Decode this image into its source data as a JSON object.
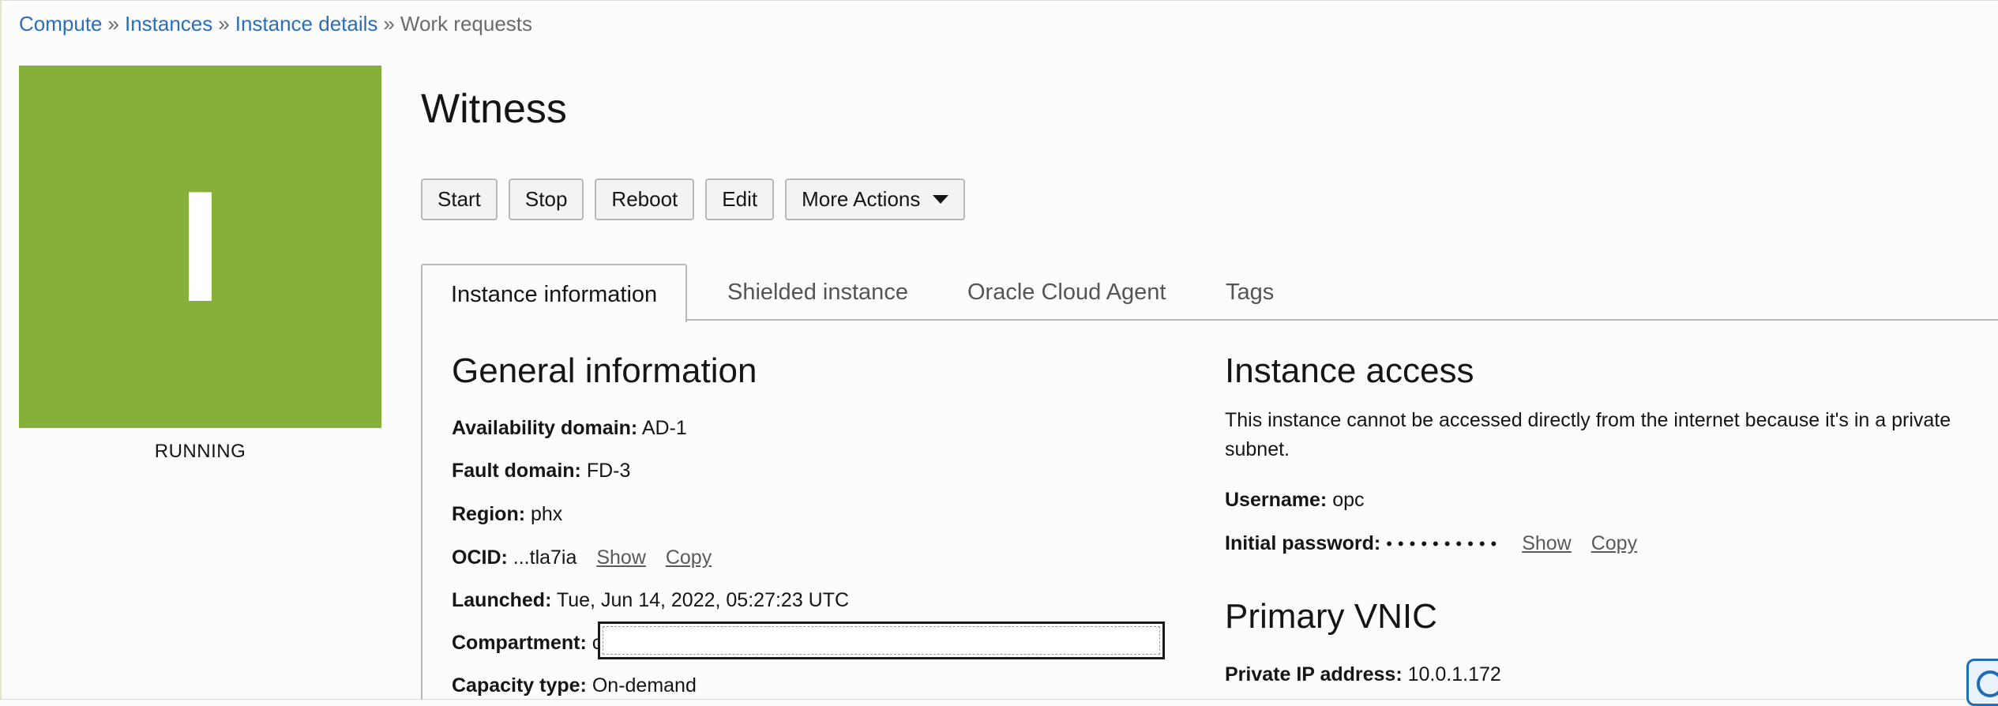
{
  "breadcrumb": {
    "items": [
      "Compute",
      "Instances",
      "Instance details"
    ],
    "current": "Work requests",
    "separator": "»"
  },
  "tile": {
    "letter": "I",
    "color": "#86b03b",
    "status": "RUNNING"
  },
  "title": "Witness",
  "actions": {
    "start": "Start",
    "stop": "Stop",
    "reboot": "Reboot",
    "edit": "Edit",
    "more": "More Actions"
  },
  "tabs": [
    {
      "label": "Instance information",
      "active": true
    },
    {
      "label": "Shielded instance",
      "active": false
    },
    {
      "label": "Oracle Cloud Agent",
      "active": false
    },
    {
      "label": "Tags",
      "active": false
    }
  ],
  "general": {
    "heading": "General information",
    "availability_label": "Availability domain:",
    "availability_value": "AD-1",
    "fault_label": "Fault domain:",
    "fault_value": "FD-3",
    "region_label": "Region:",
    "region_value": "phx",
    "ocid_label": "OCID:",
    "ocid_value": "...tla7ia",
    "ocid_show": "Show",
    "ocid_copy": "Copy",
    "launched_label": "Launched:",
    "launched_value": "Tue, Jun 14, 2022, 05:27:23 UTC",
    "compartment_label": "Compartment:",
    "compartment_value": "c",
    "capacity_label": "Capacity type:",
    "capacity_value": "On-demand"
  },
  "access": {
    "heading": "Instance access",
    "description": "This instance cannot be accessed directly from the internet because it's in a private subnet.",
    "username_label": "Username:",
    "username_value": "opc",
    "password_label": "Initial password:",
    "password_value": "••••••••••",
    "password_show": "Show",
    "password_copy": "Copy"
  },
  "vnic": {
    "heading": "Primary VNIC",
    "private_ip_label": "Private IP address:",
    "private_ip_value": "10.0.1.172"
  },
  "colors": {
    "link": "#2a6ebb",
    "tile": "#86b03b",
    "border": "#b9b9b9"
  },
  "icons": {
    "more_actions": "caret-down-icon",
    "help": "help-widget-icon"
  }
}
